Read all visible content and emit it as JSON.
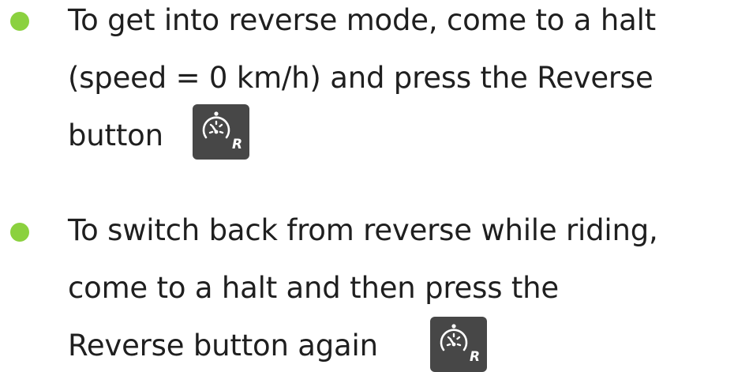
{
  "instructions": [
    {
      "lines": [
        "To get into reverse mode, come to a halt",
        "(speed = 0 km/h) and press the Reverse",
        "button"
      ],
      "button_letter": "R",
      "button_icon": "speedometer-icon"
    },
    {
      "lines": [
        "To switch back from reverse while riding,",
        "come to a halt and then press the",
        "Reverse button again"
      ],
      "button_letter": "R",
      "button_icon": "speedometer-icon"
    }
  ],
  "colors": {
    "bullet": "#8bd13f",
    "button_background": "#474747",
    "text": "#1f1f1f"
  }
}
